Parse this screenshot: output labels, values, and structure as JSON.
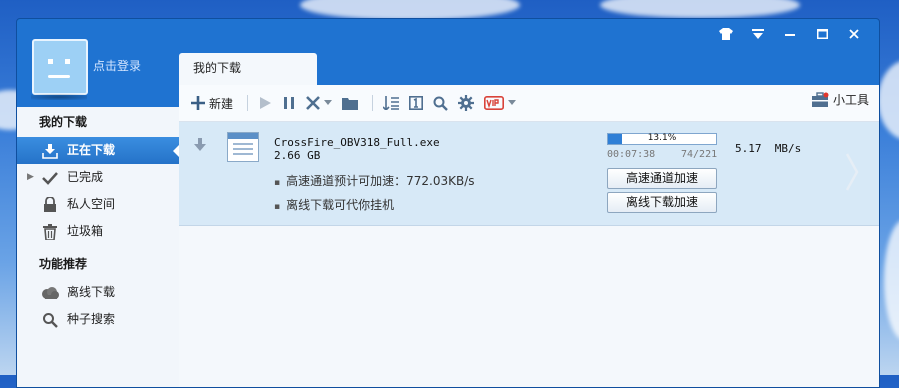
{
  "window": {
    "login_text": "点击登录",
    "title_buttons": [
      "skin-icon",
      "menu-icon",
      "minimize-icon",
      "maximize-icon",
      "close-icon"
    ]
  },
  "sidebar": {
    "my_downloads_heading": "我的下载",
    "items": [
      {
        "label": "正在下载",
        "icon": "download-icon",
        "active": true
      },
      {
        "label": "已完成",
        "icon": "check-icon",
        "active": false
      },
      {
        "label": "私人空间",
        "icon": "lock-icon",
        "active": false
      },
      {
        "label": "垃圾箱",
        "icon": "trash-icon",
        "active": false
      }
    ],
    "features_heading": "功能推荐",
    "features": [
      {
        "label": "离线下载",
        "icon": "cloud-icon"
      },
      {
        "label": "种子搜索",
        "icon": "search-icon"
      }
    ]
  },
  "tab": {
    "label": "我的下载"
  },
  "toolbar": {
    "new_label": "新建",
    "small_tools_label": "小工具",
    "icons": [
      "play-icon",
      "pause-icon",
      "delete-icon",
      "folder-icon",
      "sort-icon",
      "properties-icon",
      "search-icon",
      "settings-icon",
      "vip-icon"
    ]
  },
  "task": {
    "file_name": "CrossFire_OBV318_Full.exe",
    "file_size": "2.66 GB",
    "hint_high_speed": "高速通道预计可加速：772.03KB/s",
    "hint_offline": "离线下载可代你挂机",
    "progress": 0.131,
    "progress_text": "13.1%",
    "elapsed": "00:07:38",
    "pieces": "74/221",
    "speed": "5.17  MB/s",
    "btn_high_speed": "高速通道加速",
    "btn_offline": "离线下载加速"
  },
  "colors": {
    "accent": "#2572c8",
    "window_blue": "#1f73d1",
    "task_row": "#d7e9f7"
  }
}
